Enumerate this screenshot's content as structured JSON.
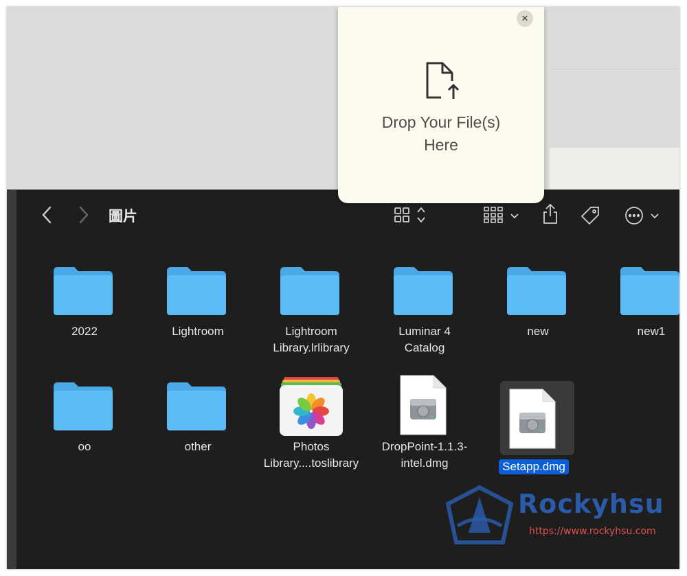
{
  "window": {
    "title": "圖片"
  },
  "drop_panel": {
    "text_line1": "Drop Your File(s)",
    "text_line2": "Here",
    "close_glyph": "×"
  },
  "toolbar": {
    "back_glyph": "<",
    "forward_glyph": ">",
    "icons": [
      "view-grid-icon",
      "sort-chevron-icon",
      "group-icon",
      "share-icon",
      "tag-icon",
      "more-icon"
    ]
  },
  "items": [
    {
      "label": "2022",
      "type": "folder"
    },
    {
      "label": "Lightroom",
      "type": "folder"
    },
    {
      "label": [
        "Lightroom",
        "Library.lrlibrary"
      ],
      "type": "folder"
    },
    {
      "label": [
        "Luminar 4",
        "Catalog"
      ],
      "type": "folder"
    },
    {
      "label": "new",
      "type": "folder"
    },
    {
      "label": "new1",
      "type": "folder"
    },
    {
      "label": "oo",
      "type": "folder"
    },
    {
      "label": "other",
      "type": "folder"
    },
    {
      "label": [
        "Photos",
        "Library....toslibrary"
      ],
      "type": "photos"
    },
    {
      "label": [
        "DropPoint-1.1.3-",
        "intel.dmg"
      ],
      "type": "dmg"
    },
    {
      "label": "Setapp.dmg",
      "type": "dmg",
      "selected": true
    }
  ],
  "watermark": {
    "brand": "Rockyhsu",
    "url": "https://www.rockyhsu.com"
  },
  "colors": {
    "folder": "#5cbcf5",
    "folder_tab": "#4aa8e6",
    "selection": "#0a5fd8",
    "finder_bg": "#1e1e1e",
    "drop_bg": "#fdfaee"
  }
}
